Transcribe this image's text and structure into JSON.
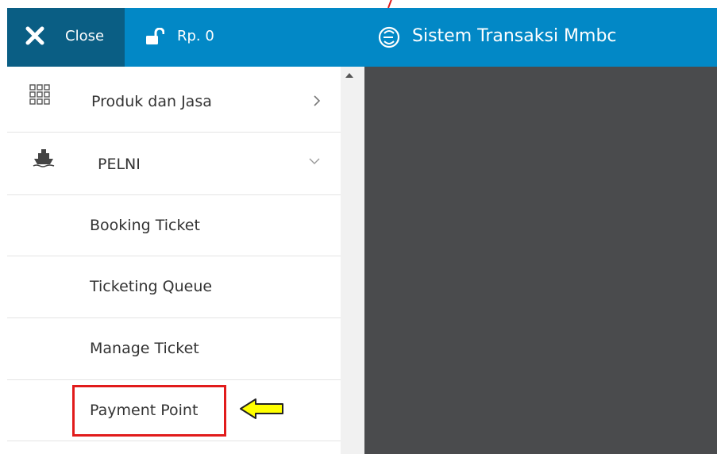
{
  "header": {
    "close_label": "Close",
    "balance_label": "Rp. 0",
    "app_title": "Sistem Transaksi Mmbc",
    "colors": {
      "bar": "#0288c6",
      "close_bg": "#0a5e84"
    }
  },
  "sidebar": {
    "items": [
      {
        "label": "Produk dan Jasa",
        "icon": "grid-icon",
        "chevron": "chevron-right-icon"
      },
      {
        "label": "PELNI",
        "icon": "ship-icon",
        "chevron": "chevron-down-icon"
      },
      {
        "label": "Booking Ticket"
      },
      {
        "label": "Ticketing Queue"
      },
      {
        "label": "Manage Ticket"
      },
      {
        "label": "Payment Point"
      }
    ]
  },
  "annotations": {
    "highlight_color": "#e11b1b",
    "arrow_color": "#ffff00"
  }
}
